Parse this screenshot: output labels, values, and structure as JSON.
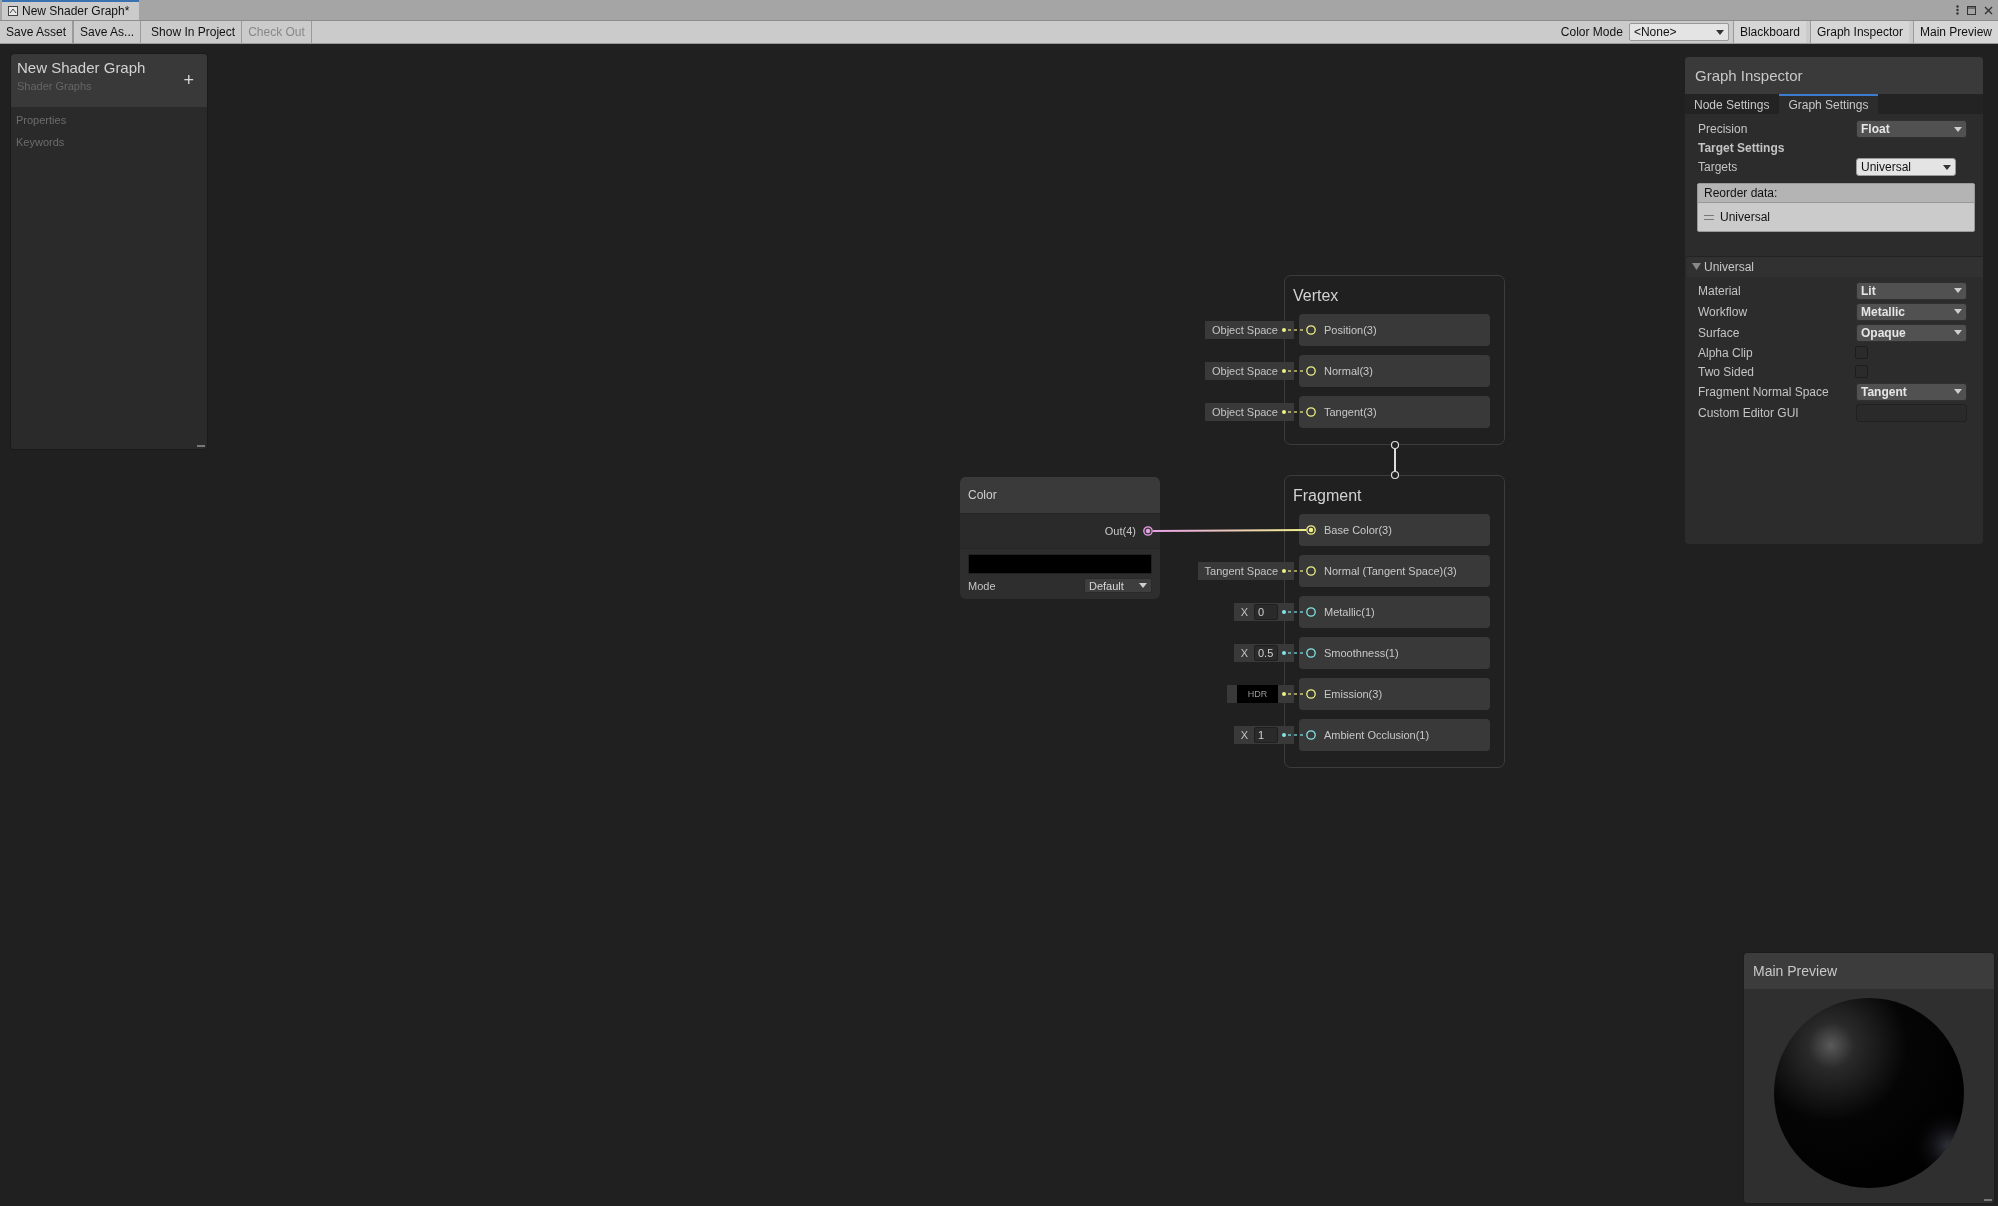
{
  "window": {
    "tab_title": "New Shader Graph*"
  },
  "toolbar": {
    "left_buttons": [
      {
        "label": "Save Asset",
        "disabled": false
      },
      {
        "label": "Save As...",
        "disabled": false
      },
      {
        "label": "Show In Project",
        "disabled": false
      },
      {
        "label": "Check Out",
        "disabled": true
      }
    ],
    "color_mode": {
      "label": "Color Mode",
      "value": "<None>"
    },
    "panel_buttons": [
      "Blackboard",
      "Graph Inspector",
      "Main Preview"
    ]
  },
  "blackboard": {
    "title": "New Shader Graph",
    "subtitle": "Shader Graphs",
    "add_button": "+",
    "sections": [
      "Properties",
      "Keywords"
    ]
  },
  "contexts": [
    {
      "title": "Vertex",
      "slots": [
        {
          "label": "Position(3)",
          "color": "#f0f08a",
          "connected": false,
          "default": {
            "kind": "space",
            "text": "Object Space"
          }
        },
        {
          "label": "Normal(3)",
          "color": "#f0f08a",
          "connected": false,
          "default": {
            "kind": "space",
            "text": "Object Space"
          }
        },
        {
          "label": "Tangent(3)",
          "color": "#f0f08a",
          "connected": false,
          "default": {
            "kind": "space",
            "text": "Object Space"
          }
        }
      ]
    },
    {
      "title": "Fragment",
      "slots": [
        {
          "label": "Base Color(3)",
          "color": "#f0f08a",
          "connected": true
        },
        {
          "label": "Normal (Tangent Space)(3)",
          "color": "#f0f08a",
          "connected": false,
          "default": {
            "kind": "space",
            "text": "Tangent Space"
          }
        },
        {
          "label": "Metallic(1)",
          "color": "#84e4e7",
          "connected": false,
          "default": {
            "kind": "float",
            "axis": "X",
            "value": "0"
          }
        },
        {
          "label": "Smoothness(1)",
          "color": "#84e4e7",
          "connected": false,
          "default": {
            "kind": "float",
            "axis": "X",
            "value": "0.5"
          }
        },
        {
          "label": "Emission(3)",
          "color": "#f0f08a",
          "connected": false,
          "default": {
            "kind": "hdr",
            "text": "HDR"
          }
        },
        {
          "label": "Ambient Occlusion(1)",
          "color": "#84e4e7",
          "connected": false,
          "default": {
            "kind": "float",
            "axis": "X",
            "value": "1"
          }
        }
      ]
    }
  ],
  "nodes": [
    {
      "title": "Color",
      "output": {
        "label": "Out(4)",
        "color": "#e8a0e8"
      },
      "mode_label": "Mode",
      "mode_value": "Default"
    }
  ],
  "inspector": {
    "title": "Graph Inspector",
    "tabs": [
      {
        "label": "Node Settings",
        "selected": false
      },
      {
        "label": "Graph Settings",
        "selected": true
      }
    ],
    "settings": [
      {
        "kind": "dropdown",
        "label": "Precision",
        "value": "Float"
      },
      {
        "kind": "heading",
        "label": "Target Settings"
      },
      {
        "kind": "mask_dropdown",
        "label": "Targets",
        "value": "Universal"
      },
      {
        "kind": "reorder_list",
        "header": "Reorder data:",
        "items": [
          "Universal"
        ]
      }
    ],
    "target_sections": [
      {
        "title": "Universal",
        "expanded": true,
        "settings": [
          {
            "kind": "dropdown",
            "label": "Material",
            "value": "Lit"
          },
          {
            "kind": "dropdown",
            "label": "Workflow",
            "value": "Metallic"
          },
          {
            "kind": "dropdown",
            "label": "Surface",
            "value": "Opaque"
          },
          {
            "kind": "checkbox",
            "label": "Alpha Clip",
            "checked": false
          },
          {
            "kind": "checkbox",
            "label": "Two Sided",
            "checked": false
          },
          {
            "kind": "dropdown",
            "label": "Fragment Normal Space",
            "value": "Tangent"
          },
          {
            "kind": "text",
            "label": "Custom Editor GUI"
          }
        ]
      }
    ]
  },
  "main_preview": {
    "title": "Main Preview"
  }
}
